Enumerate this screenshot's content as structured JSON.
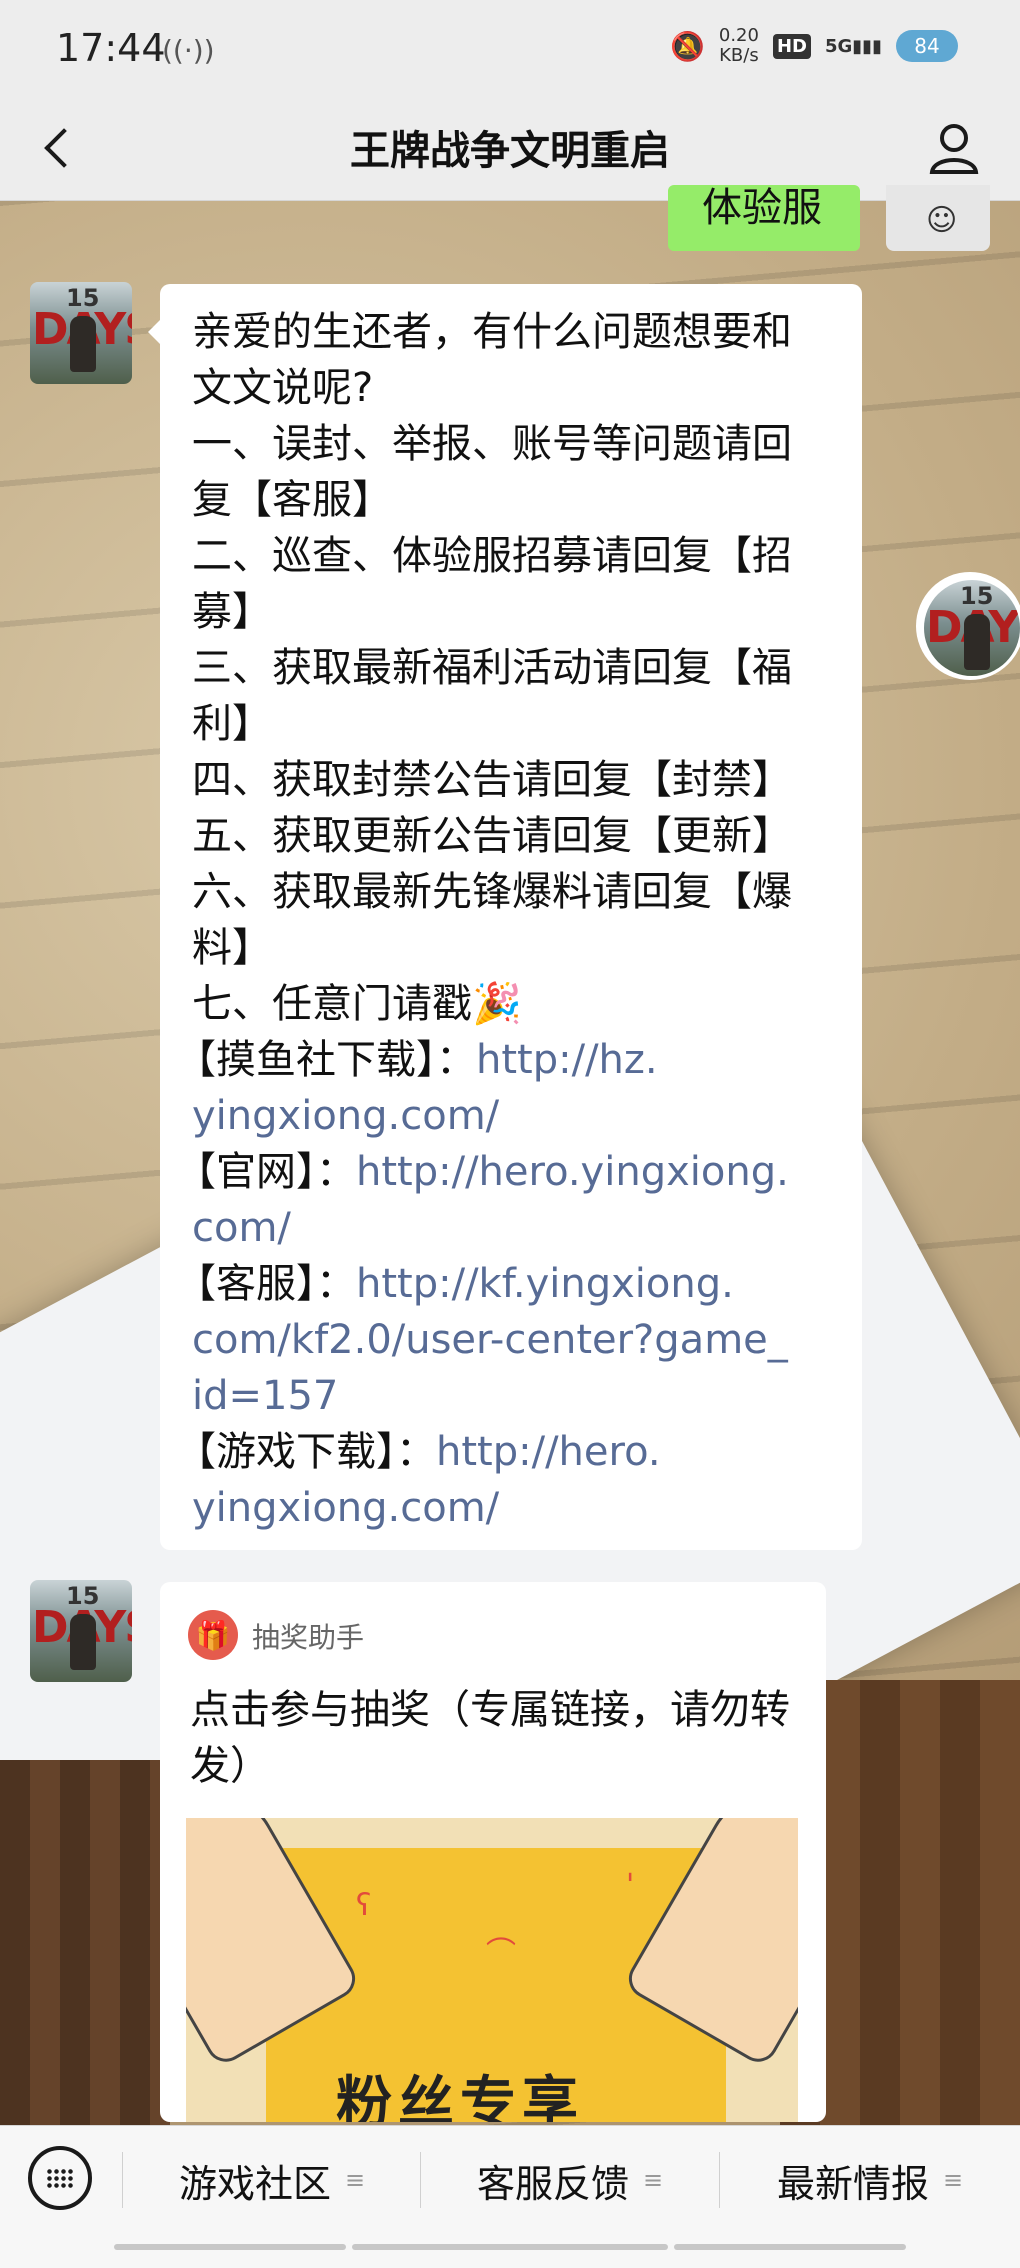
{
  "status_bar": {
    "time": "17:44",
    "speed_value": "0.20",
    "speed_unit": "KB/s",
    "hd": "HD",
    "signal": "5G",
    "battery": "84"
  },
  "nav": {
    "title": "王牌战争文明重启"
  },
  "chat": {
    "partial_sent_text": "体验服",
    "message1_lines": [
      {
        "text": "亲爱的生还者，有什么问题想要和"
      },
      {
        "text": "文文说呢?"
      },
      {
        "text": "一、误封、举报、账号等问题请回"
      },
      {
        "text": "复【客服】"
      },
      {
        "text": "二、巡查、体验服招募请回复【招"
      },
      {
        "text": "募】"
      },
      {
        "text": "三、获取最新福利活动请回复【福"
      },
      {
        "text": "利】"
      },
      {
        "text": "四、获取封禁公告请回复【封禁】"
      },
      {
        "text": "五、获取更新公告请回复【更新】"
      },
      {
        "text": "六、获取最新先锋爆料请回复【爆"
      },
      {
        "text": "料】"
      },
      {
        "text": "七、任意门请戳🎉"
      }
    ],
    "links": [
      {
        "label": "【摸鱼社下载】：",
        "url_line1": "http://hz.",
        "url_line2": "yingxiong.com/",
        "url_line3": ""
      },
      {
        "label": "【官网】：",
        "url_line1": "http://hero.yingxiong.",
        "url_line2": "com/",
        "url_line3": ""
      },
      {
        "label": "【客服】：",
        "url_line1": "http://kf.yingxiong.",
        "url_line2": "com/kf2.0/user-center?game_",
        "url_line3": "id=157"
      },
      {
        "label": "【游戏下载】：",
        "url_line1": "http://hero.",
        "url_line2": "yingxiong.com/",
        "url_line3": ""
      }
    ],
    "card": {
      "source": "抽奖助手",
      "text": "点击参与抽奖（专属链接，请勿转发）",
      "image_text": "粉丝专享"
    },
    "avatar_text_top": "15",
    "avatar_text_main": "DAYS"
  },
  "bottom_menu": {
    "items": [
      "游戏社区",
      "客服反馈",
      "最新情报"
    ]
  }
}
